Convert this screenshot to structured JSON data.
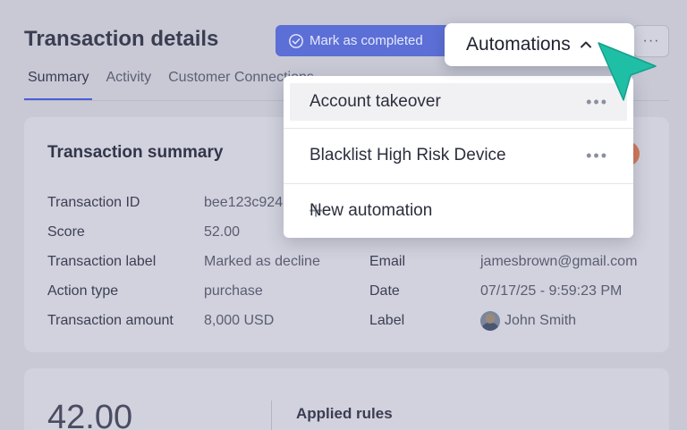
{
  "page": {
    "title": "Transaction details",
    "mark_completed_label": "Mark as completed",
    "more_label": "···",
    "automations_label": "Automations"
  },
  "tabs": [
    {
      "label": "Summary",
      "active": true
    },
    {
      "label": "Activity",
      "active": false
    },
    {
      "label": "Customer Connections",
      "active": false
    }
  ],
  "summary": {
    "title": "Transaction summary",
    "rows_left": [
      {
        "label": "Transaction ID",
        "value": "bee123c924"
      },
      {
        "label": "Score",
        "value": "52.00"
      },
      {
        "label": "Transaction label",
        "value": "Marked as decline"
      },
      {
        "label": "Action type",
        "value": "purchase"
      },
      {
        "label": "Transaction amount",
        "value": "8,000 USD"
      }
    ],
    "rows_right": [
      {
        "label": "Email",
        "value": "jamesbrown@gmail.com"
      },
      {
        "label": "Date",
        "value": "07/17/25 - 9:59:23 PM"
      },
      {
        "label": "Label",
        "value": "John Smith"
      }
    ]
  },
  "lower": {
    "score_value": "42.00",
    "applied_rules_label": "Applied rules"
  },
  "menu": {
    "items": [
      {
        "label": "Account takeover",
        "more": "•••"
      },
      {
        "label": "Blacklist High Risk Device",
        "more": "•••"
      }
    ],
    "new_label": "New automation",
    "new_icon": "+"
  },
  "colors": {
    "accent": "#5b6fd6",
    "cursor": "#1fbfa6",
    "backdrop": "#c8c9d5"
  }
}
